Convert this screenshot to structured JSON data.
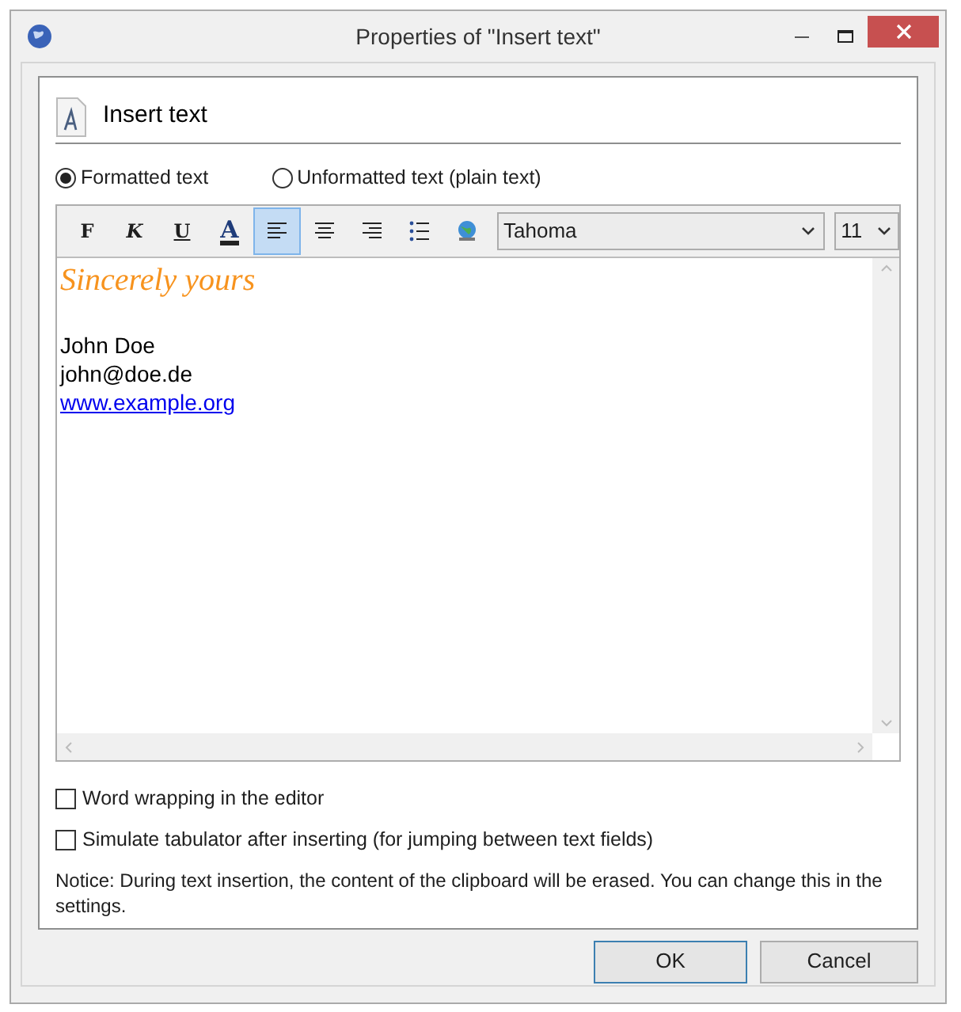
{
  "window": {
    "title": "Properties of \"Insert text\""
  },
  "header": {
    "title": "Insert text"
  },
  "modes": [
    {
      "label": "Formatted text",
      "selected": true
    },
    {
      "label": "Unformatted text (plain text)",
      "selected": false
    }
  ],
  "toolbar": {
    "buttons": [
      {
        "kind": "bold",
        "label": "F",
        "selected": false
      },
      {
        "kind": "italic",
        "label": "K",
        "selected": false
      },
      {
        "kind": "underline",
        "label": "U",
        "selected": false
      },
      {
        "kind": "color",
        "label": "A",
        "selected": false
      },
      {
        "kind": "align-left",
        "selected": true
      },
      {
        "kind": "align-center",
        "selected": false
      },
      {
        "kind": "align-right",
        "selected": false
      },
      {
        "kind": "list",
        "selected": false
      },
      {
        "kind": "link",
        "selected": false
      }
    ],
    "font": "Tahoma",
    "size": "11"
  },
  "editor": {
    "lines": [
      {
        "kind": "script",
        "text": "Sincerely yours"
      },
      {
        "kind": "plain",
        "text": "John Doe"
      },
      {
        "kind": "plain",
        "text": "john@doe.de"
      },
      {
        "kind": "link",
        "text": "www.example.org"
      }
    ]
  },
  "options": [
    {
      "label": "Word wrapping in the editor",
      "checked": false
    },
    {
      "label": "Simulate tabulator after inserting (for jumping between text fields)",
      "checked": false
    }
  ],
  "notice": "Notice: During text insertion, the content of the clipboard will be erased. You can change this in the settings.",
  "buttons": [
    {
      "label": "OK",
      "default": true
    },
    {
      "label": "Cancel",
      "default": false
    }
  ]
}
